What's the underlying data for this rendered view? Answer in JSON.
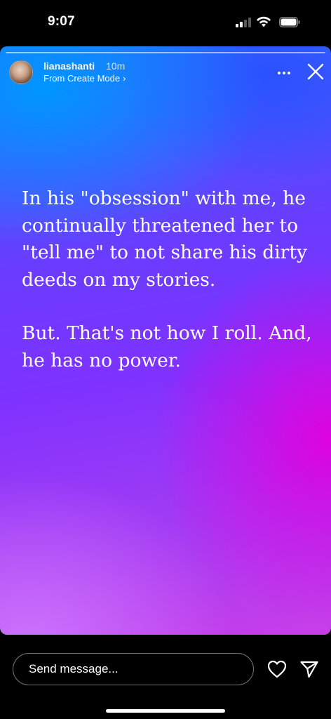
{
  "status_bar": {
    "time": "9:07",
    "signal_icon": "cellular-signal-icon",
    "wifi_icon": "wifi-icon",
    "battery_icon": "battery-icon"
  },
  "story": {
    "segments": 1,
    "username": "lianashanti",
    "time_ago": "10m",
    "subtitle": "From Create Mode",
    "subtitle_chevron": "›",
    "more_icon": "more-horizontal-icon",
    "close_icon": "close-icon",
    "paragraphs": [
      "In his \"obsession\" with me, he continually threatened her to \"tell me\" to not share his dirty deeds on my stories.",
      "But. That's not how I roll. And, he has no power."
    ],
    "colors": {
      "top_left": "#0096ff",
      "middle": "#7f32ff",
      "right": "#e200de",
      "bottom_left": "#cd78ff"
    }
  },
  "bottom_bar": {
    "message_placeholder": "Send message...",
    "heart_icon": "heart-icon",
    "send_icon": "send-icon"
  }
}
